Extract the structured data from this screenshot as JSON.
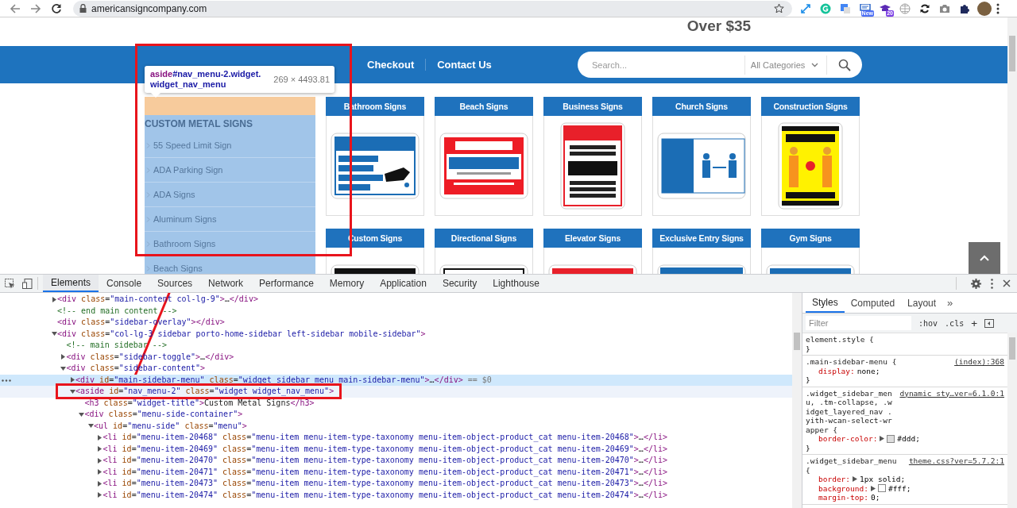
{
  "browser": {
    "url": "americansigncompany.com",
    "extensions": [
      {
        "kind": "expand"
      },
      {
        "kind": "grammar"
      },
      {
        "kind": "translate"
      },
      {
        "kind": "news",
        "badge": "New"
      },
      {
        "kind": "school",
        "badge": "20"
      },
      {
        "kind": "globe"
      },
      {
        "kind": "sync"
      },
      {
        "kind": "camera"
      },
      {
        "kind": "puzzle"
      }
    ]
  },
  "page": {
    "promo": "Over $35",
    "nav": [
      "Checkout",
      "Contact Us"
    ],
    "search": {
      "placeholder": "Search...",
      "category": "All Categories"
    },
    "tooltip": {
      "tag": "aside",
      "selector": "#nav_menu-2.widget.widget_nav_menu",
      "size": "269 × 4493.81"
    },
    "sidebar": {
      "title": "CUSTOM METAL SIGNS",
      "items": [
        "55 Speed Limit Sign",
        "ADA Parking Sign",
        "ADA Signs",
        "Aluminum Signs",
        "Bathroom Signs",
        "Beach Signs"
      ]
    },
    "categories": [
      {
        "title": "Bathroom Signs",
        "kind": "wash-hands"
      },
      {
        "title": "Beach Signs",
        "kind": "beach-closed"
      },
      {
        "title": "Business Signs",
        "kind": "covid"
      },
      {
        "title": "Church Signs",
        "kind": "church"
      },
      {
        "title": "Construction Signs",
        "kind": "construction"
      },
      {
        "title": "Custom Signs",
        "kind": "caution"
      },
      {
        "title": "Directional Signs",
        "kind": "notice"
      },
      {
        "title": "Elevator Signs",
        "kind": "warning-red"
      },
      {
        "title": "Exclusive Entry Signs",
        "kind": "no-entry"
      },
      {
        "title": "Gym Signs",
        "kind": "attention-blue"
      }
    ]
  },
  "devtools": {
    "tabs": [
      {
        "label": "Elements",
        "selected": true
      },
      {
        "label": "Console",
        "selected": false
      },
      {
        "label": "Sources",
        "selected": false
      },
      {
        "label": "Network",
        "selected": false
      },
      {
        "label": "Performance",
        "selected": false
      },
      {
        "label": "Memory",
        "selected": false
      },
      {
        "label": "Application",
        "selected": false
      },
      {
        "label": "Security",
        "selected": false
      },
      {
        "label": "Lighthouse",
        "selected": false
      }
    ],
    "dom": [
      {
        "expanded": false,
        "selected": false,
        "hovered": false,
        "segments": [
          {
            "kind": "tag",
            "text": "<div"
          },
          {
            "kind": "attr",
            "text": " class"
          },
          {
            "kind": "punct",
            "text": "="
          },
          {
            "kind": "value",
            "text": "\"main-content col-lg-9\""
          },
          {
            "kind": "tag",
            "text": ">"
          },
          {
            "kind": "text",
            "text": "…"
          },
          {
            "kind": "tag",
            "text": "</div>"
          }
        ]
      },
      {
        "selected": false,
        "hovered": false,
        "segments": [
          {
            "kind": "comment",
            "text": "<!-- end main content -->"
          }
        ]
      },
      {
        "selected": false,
        "hovered": false,
        "segments": [
          {
            "kind": "tag",
            "text": "<div"
          },
          {
            "kind": "attr",
            "text": " class"
          },
          {
            "kind": "punct",
            "text": "="
          },
          {
            "kind": "value",
            "text": "\"sidebar-overlay\""
          },
          {
            "kind": "tag",
            "text": "></div>"
          }
        ]
      },
      {
        "expanded": true,
        "selected": false,
        "hovered": false,
        "segments": [
          {
            "kind": "tag",
            "text": "<div"
          },
          {
            "kind": "attr",
            "text": " class"
          },
          {
            "kind": "punct",
            "text": "="
          },
          {
            "kind": "value",
            "text": "\"col-lg-3 sidebar porto-home-sidebar left-sidebar mobile-sidebar\""
          },
          {
            "kind": "tag",
            "text": ">"
          }
        ],
        "children": [
          {
            "selected": false,
            "hovered": false,
            "segments": [
              {
                "kind": "comment",
                "text": "<!-- main sidebar -->"
              }
            ]
          },
          {
            "expanded": false,
            "selected": false,
            "hovered": false,
            "segments": [
              {
                "kind": "tag",
                "text": "<div"
              },
              {
                "kind": "attr",
                "text": " class"
              },
              {
                "kind": "punct",
                "text": "="
              },
              {
                "kind": "value",
                "text": "\"sidebar-toggle\""
              },
              {
                "kind": "tag",
                "text": ">"
              },
              {
                "kind": "text",
                "text": "…"
              },
              {
                "kind": "tag",
                "text": "</div>"
              }
            ]
          },
          {
            "expanded": true,
            "selected": false,
            "hovered": false,
            "segments": [
              {
                "kind": "tag",
                "text": "<div"
              },
              {
                "kind": "attr",
                "text": " class"
              },
              {
                "kind": "punct",
                "text": "="
              },
              {
                "kind": "value",
                "text": "\"sidebar-content\""
              },
              {
                "kind": "tag",
                "text": ">"
              }
            ],
            "children": [
              {
                "expanded": false,
                "selected": true,
                "hovered": false,
                "segments": [
                  {
                    "kind": "tag",
                    "text": "<div"
                  },
                  {
                    "kind": "attr",
                    "text": " id"
                  },
                  {
                    "kind": "punct",
                    "text": "="
                  },
                  {
                    "kind": "value",
                    "text": "\"main-sidebar-menu\""
                  },
                  {
                    "kind": "attr",
                    "text": " class"
                  },
                  {
                    "kind": "punct",
                    "text": "="
                  },
                  {
                    "kind": "value",
                    "text": "\"widget_sidebar_menu main-sidebar-menu\""
                  },
                  {
                    "kind": "tag",
                    "text": ">"
                  },
                  {
                    "kind": "text",
                    "text": "…"
                  },
                  {
                    "kind": "tag",
                    "text": "</div>"
                  },
                  {
                    "kind": "note",
                    "text": " == $0"
                  }
                ]
              },
              {
                "expanded": true,
                "selected": false,
                "hovered": true,
                "segments": [
                  {
                    "kind": "tag",
                    "text": "<aside"
                  },
                  {
                    "kind": "attr",
                    "text": " id"
                  },
                  {
                    "kind": "punct",
                    "text": "="
                  },
                  {
                    "kind": "value",
                    "text": "\"nav_menu-2\""
                  },
                  {
                    "kind": "attr",
                    "text": " class"
                  },
                  {
                    "kind": "punct",
                    "text": "="
                  },
                  {
                    "kind": "value",
                    "text": "\"widget widget_nav_menu\""
                  },
                  {
                    "kind": "tag",
                    "text": ">"
                  }
                ],
                "children": [
                  {
                    "selected": false,
                    "hovered": false,
                    "segments": [
                      {
                        "kind": "tag",
                        "text": "<h3"
                      },
                      {
                        "kind": "attr",
                        "text": " class"
                      },
                      {
                        "kind": "punct",
                        "text": "="
                      },
                      {
                        "kind": "value",
                        "text": "\"widget-title\""
                      },
                      {
                        "kind": "tag",
                        "text": ">"
                      },
                      {
                        "kind": "text",
                        "text": "Custom Metal Signs"
                      },
                      {
                        "kind": "tag",
                        "text": "</h3>"
                      }
                    ]
                  },
                  {
                    "expanded": true,
                    "selected": false,
                    "hovered": false,
                    "segments": [
                      {
                        "kind": "tag",
                        "text": "<div"
                      },
                      {
                        "kind": "attr",
                        "text": " class"
                      },
                      {
                        "kind": "punct",
                        "text": "="
                      },
                      {
                        "kind": "value",
                        "text": "\"menu-side-container\""
                      },
                      {
                        "kind": "tag",
                        "text": ">"
                      }
                    ],
                    "children": [
                      {
                        "expanded": true,
                        "selected": false,
                        "hovered": false,
                        "segments": [
                          {
                            "kind": "tag",
                            "text": "<ul"
                          },
                          {
                            "kind": "attr",
                            "text": " id"
                          },
                          {
                            "kind": "punct",
                            "text": "="
                          },
                          {
                            "kind": "value",
                            "text": "\"menu-side\""
                          },
                          {
                            "kind": "attr",
                            "text": " class"
                          },
                          {
                            "kind": "punct",
                            "text": "="
                          },
                          {
                            "kind": "value",
                            "text": "\"menu\""
                          },
                          {
                            "kind": "tag",
                            "text": ">"
                          }
                        ],
                        "children": [
                          {
                            "expanded": false,
                            "selected": false,
                            "hovered": false,
                            "segments": [
                              {
                                "kind": "tag",
                                "text": "<li"
                              },
                              {
                                "kind": "attr",
                                "text": " id"
                              },
                              {
                                "kind": "punct",
                                "text": "="
                              },
                              {
                                "kind": "value",
                                "text": "\"menu-item-20468\""
                              },
                              {
                                "kind": "attr",
                                "text": " class"
                              },
                              {
                                "kind": "punct",
                                "text": "="
                              },
                              {
                                "kind": "value",
                                "text": "\"menu-item menu-item-type-taxonomy menu-item-object-product_cat menu-item-20468\""
                              },
                              {
                                "kind": "tag",
                                "text": ">"
                              },
                              {
                                "kind": "text",
                                "text": "…"
                              },
                              {
                                "kind": "tag",
                                "text": "</li>"
                              }
                            ]
                          },
                          {
                            "expanded": false,
                            "selected": false,
                            "hovered": false,
                            "segments": [
                              {
                                "kind": "tag",
                                "text": "<li"
                              },
                              {
                                "kind": "attr",
                                "text": " id"
                              },
                              {
                                "kind": "punct",
                                "text": "="
                              },
                              {
                                "kind": "value",
                                "text": "\"menu-item-20469\""
                              },
                              {
                                "kind": "attr",
                                "text": " class"
                              },
                              {
                                "kind": "punct",
                                "text": "="
                              },
                              {
                                "kind": "value",
                                "text": "\"menu-item menu-item-type-taxonomy menu-item-object-product_cat menu-item-20469\""
                              },
                              {
                                "kind": "tag",
                                "text": ">"
                              },
                              {
                                "kind": "text",
                                "text": "…"
                              },
                              {
                                "kind": "tag",
                                "text": "</li>"
                              }
                            ]
                          },
                          {
                            "expanded": false,
                            "selected": false,
                            "hovered": false,
                            "segments": [
                              {
                                "kind": "tag",
                                "text": "<li"
                              },
                              {
                                "kind": "attr",
                                "text": " id"
                              },
                              {
                                "kind": "punct",
                                "text": "="
                              },
                              {
                                "kind": "value",
                                "text": "\"menu-item-20470\""
                              },
                              {
                                "kind": "attr",
                                "text": " class"
                              },
                              {
                                "kind": "punct",
                                "text": "="
                              },
                              {
                                "kind": "value",
                                "text": "\"menu-item menu-item-type-taxonomy menu-item-object-product_cat menu-item-20470\""
                              },
                              {
                                "kind": "tag",
                                "text": ">"
                              },
                              {
                                "kind": "text",
                                "text": "…"
                              },
                              {
                                "kind": "tag",
                                "text": "</li>"
                              }
                            ]
                          },
                          {
                            "expanded": false,
                            "selected": false,
                            "hovered": false,
                            "segments": [
                              {
                                "kind": "tag",
                                "text": "<li"
                              },
                              {
                                "kind": "attr",
                                "text": " id"
                              },
                              {
                                "kind": "punct",
                                "text": "="
                              },
                              {
                                "kind": "value",
                                "text": "\"menu-item-20471\""
                              },
                              {
                                "kind": "attr",
                                "text": " class"
                              },
                              {
                                "kind": "punct",
                                "text": "="
                              },
                              {
                                "kind": "value",
                                "text": "\"menu-item menu-item-type-taxonomy menu-item-object-product_cat menu-item-20471\""
                              },
                              {
                                "kind": "tag",
                                "text": ">"
                              },
                              {
                                "kind": "text",
                                "text": "…"
                              },
                              {
                                "kind": "tag",
                                "text": "</li>"
                              }
                            ]
                          },
                          {
                            "expanded": false,
                            "selected": false,
                            "hovered": false,
                            "segments": [
                              {
                                "kind": "tag",
                                "text": "<li"
                              },
                              {
                                "kind": "attr",
                                "text": " id"
                              },
                              {
                                "kind": "punct",
                                "text": "="
                              },
                              {
                                "kind": "value",
                                "text": "\"menu-item-20473\""
                              },
                              {
                                "kind": "attr",
                                "text": " class"
                              },
                              {
                                "kind": "punct",
                                "text": "="
                              },
                              {
                                "kind": "value",
                                "text": "\"menu-item menu-item-type-taxonomy menu-item-object-product_cat menu-item-20473\""
                              },
                              {
                                "kind": "tag",
                                "text": ">"
                              },
                              {
                                "kind": "text",
                                "text": "…"
                              },
                              {
                                "kind": "tag",
                                "text": "</li>"
                              }
                            ]
                          },
                          {
                            "expanded": false,
                            "selected": false,
                            "hovered": false,
                            "segments": [
                              {
                                "kind": "tag",
                                "text": "<li"
                              },
                              {
                                "kind": "attr",
                                "text": " id"
                              },
                              {
                                "kind": "punct",
                                "text": "="
                              },
                              {
                                "kind": "value",
                                "text": "\"menu-item-20474\""
                              },
                              {
                                "kind": "attr",
                                "text": " class"
                              },
                              {
                                "kind": "punct",
                                "text": "="
                              },
                              {
                                "kind": "value",
                                "text": "\"menu-item menu-item-type-taxonomy menu-item-object-product_cat menu-item-20474\""
                              },
                              {
                                "kind": "tag",
                                "text": ">"
                              },
                              {
                                "kind": "text",
                                "text": "…"
                              },
                              {
                                "kind": "tag",
                                "text": "</li>"
                              }
                            ]
                          }
                        ]
                      }
                    ]
                  }
                ]
              }
            ]
          }
        ]
      }
    ],
    "styles": {
      "tabs": [
        {
          "label": "Styles",
          "selected": true
        },
        {
          "label": "Computed",
          "selected": false
        },
        {
          "label": "Layout",
          "selected": false
        }
      ],
      "more": "»",
      "filter_placeholder": "Filter",
      "hov": ":hov",
      "cls": ".cls",
      "add": "+",
      "rules": [
        {
          "selector": "element.style {",
          "close": "}"
        },
        {
          "selector": ".main-sidebar-menu {",
          "source": "(index):368",
          "props": [
            {
              "name": "display:",
              "value": "none;",
              "expandable": false
            }
          ],
          "close": "}"
        },
        {
          "selector": ".widget_sidebar_menu, .tm-collapse, .widget_layered_nav .yith-wcan-select-wrapper {",
          "source": "dynamic_sty…ver=6.1.0:1",
          "props": [
            {
              "name": "border-color:",
              "value": "#ddd;",
              "expandable": true,
              "color": "#dddddd"
            }
          ],
          "close": "}"
        },
        {
          "selector": ".widget_sidebar_menu {",
          "source": "theme.css?ver=5.7.2:1",
          "props": [
            {
              "name": "border:",
              "value": "1px solid;",
              "expandable": true
            },
            {
              "name": "background:",
              "value": "#fff;",
              "expandable": true,
              "color": "#ffffff"
            },
            {
              "name": "margin-top:",
              "value": "0;",
              "expandable": false
            }
          ]
        }
      ]
    }
  }
}
